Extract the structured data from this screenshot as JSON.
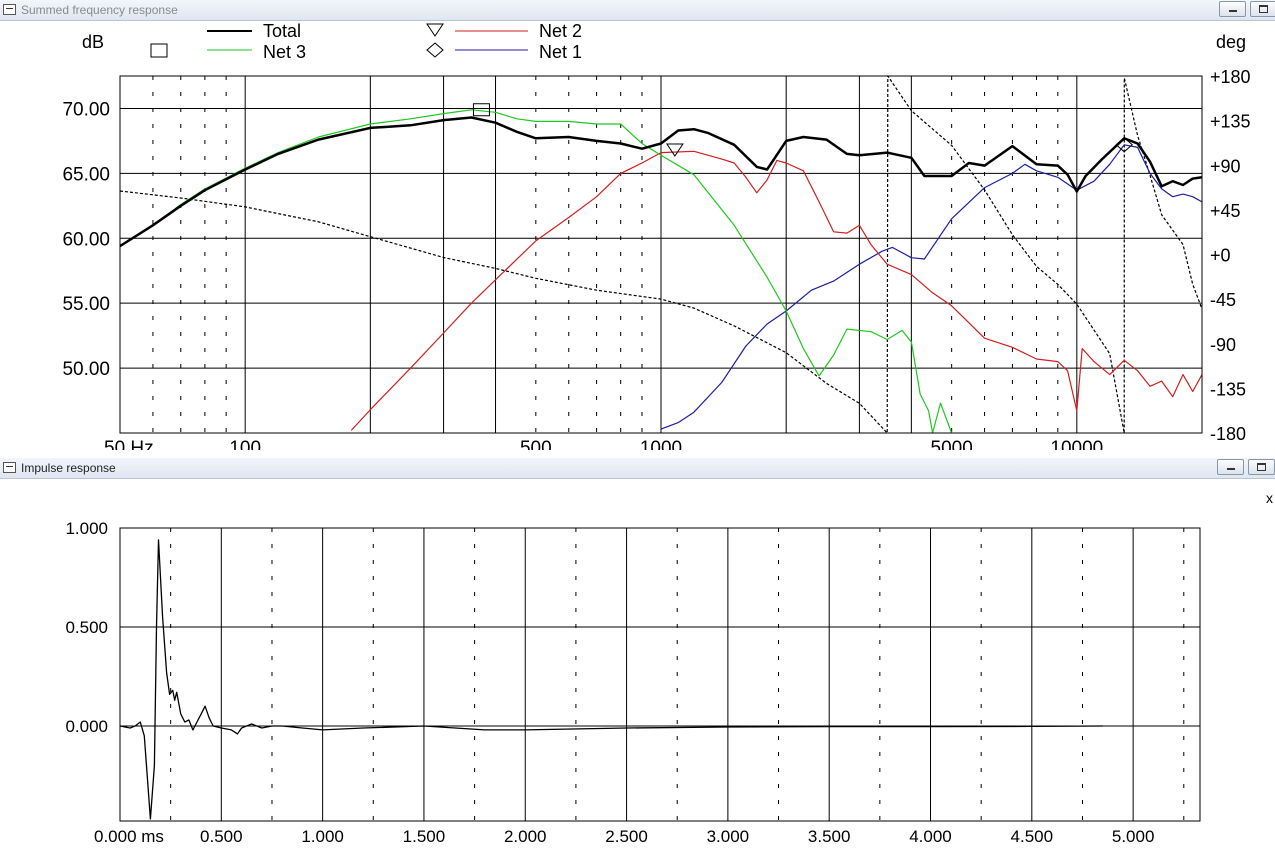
{
  "windows": {
    "freq": {
      "title": "Summed frequency response"
    },
    "impulse": {
      "title": "Impulse response",
      "side_label": "x"
    }
  },
  "freq_chart": {
    "unit_left": "dB",
    "unit_right": "deg",
    "y_ticks": [
      "70.00",
      "65.00",
      "60.00",
      "55.00",
      "50.00"
    ],
    "phase_ticks": [
      "+180",
      "+135",
      "+90",
      "+45",
      "+0",
      "-45",
      "-90",
      "-135",
      "-180"
    ],
    "x_ticks": [
      "50 Hz",
      "100",
      "500",
      "1000",
      "5000",
      "10000"
    ],
    "legend": {
      "total": "Total",
      "net3": "Net 3",
      "net2": "Net 2",
      "net1": "Net 1"
    }
  },
  "impulse_chart": {
    "y_ticks": [
      "1.000",
      "0.500",
      "0.000"
    ],
    "x_ticks": [
      "0.000 ms",
      "0.500",
      "1.000",
      "1.500",
      "2.000",
      "2.500",
      "3.000",
      "3.500",
      "4.000",
      "4.500",
      "5.000"
    ]
  },
  "colors": {
    "total": "#000000",
    "net3": "#1ec81e",
    "net2": "#d21e1e",
    "net1": "#1e1ea0",
    "phase": "#000000"
  },
  "chart_data": [
    {
      "type": "line",
      "title": "Summed frequency response",
      "xscale": "log",
      "xlim": [
        50,
        20000
      ],
      "ylim": [
        45,
        72.5
      ],
      "y2lim": [
        -180,
        180
      ],
      "ylabel": "dB",
      "y2label": "deg",
      "grid": true,
      "legend_position": "top",
      "series": [
        {
          "name": "Total",
          "axis": "left",
          "color": "#000000",
          "points": [
            [
              50,
              59.4
            ],
            [
              60,
              61
            ],
            [
              70,
              62.5
            ],
            [
              80,
              63.7
            ],
            [
              100,
              65.3
            ],
            [
              120,
              66.5
            ],
            [
              150,
              67.6
            ],
            [
              200,
              68.5
            ],
            [
              250,
              68.7
            ],
            [
              300,
              69.1
            ],
            [
              350,
              69.3
            ],
            [
              400,
              68.9
            ],
            [
              450,
              68.2
            ],
            [
              500,
              67.7
            ],
            [
              600,
              67.8
            ],
            [
              700,
              67.5
            ],
            [
              800,
              67.3
            ],
            [
              900,
              66.9
            ],
            [
              1000,
              67.3
            ],
            [
              1100,
              68.3
            ],
            [
              1200,
              68.4
            ],
            [
              1300,
              68.1
            ],
            [
              1500,
              67.2
            ],
            [
              1700,
              65.5
            ],
            [
              1800,
              65.3
            ],
            [
              2000,
              67.5
            ],
            [
              2200,
              67.8
            ],
            [
              2500,
              67.6
            ],
            [
              2800,
              66.5
            ],
            [
              3000,
              66.4
            ],
            [
              3500,
              66.6
            ],
            [
              4000,
              66.2
            ],
            [
              4300,
              64.8
            ],
            [
              5000,
              64.8
            ],
            [
              5500,
              65.8
            ],
            [
              6000,
              65.6
            ],
            [
              7000,
              67.1
            ],
            [
              8000,
              65.7
            ],
            [
              9000,
              65.6
            ],
            [
              9500,
              64.9
            ],
            [
              10000,
              63.6
            ],
            [
              10500,
              64.8
            ],
            [
              11500,
              66.1
            ],
            [
              13000,
              67.7
            ],
            [
              14000,
              67.3
            ],
            [
              15000,
              65.9
            ],
            [
              16000,
              64.0
            ],
            [
              17000,
              64.4
            ],
            [
              18000,
              64.1
            ],
            [
              19000,
              64.6
            ],
            [
              20000,
              64.7
            ]
          ]
        },
        {
          "name": "Net 3",
          "axis": "left",
          "color": "#1ec81e",
          "points": [
            [
              50,
              59.4
            ],
            [
              60,
              61
            ],
            [
              70,
              62.6
            ],
            [
              80,
              63.8
            ],
            [
              100,
              65.4
            ],
            [
              120,
              66.6
            ],
            [
              150,
              67.8
            ],
            [
              200,
              68.8
            ],
            [
              250,
              69.2
            ],
            [
              300,
              69.6
            ],
            [
              350,
              69.9
            ],
            [
              400,
              69.7
            ],
            [
              450,
              69.2
            ],
            [
              500,
              69.0
            ],
            [
              600,
              69.0
            ],
            [
              700,
              68.8
            ],
            [
              800,
              68.8
            ],
            [
              900,
              67.3
            ],
            [
              1000,
              66.4
            ],
            [
              1200,
              64.9
            ],
            [
              1500,
              61.0
            ],
            [
              1800,
              57.0
            ],
            [
              2000,
              54.4
            ],
            [
              2200,
              51.5
            ],
            [
              2400,
              49.4
            ],
            [
              2600,
              51.0
            ],
            [
              2800,
              53.0
            ],
            [
              3200,
              52.8
            ],
            [
              3500,
              52.2
            ],
            [
              3800,
              52.9
            ],
            [
              4000,
              52.0
            ],
            [
              4200,
              48.0
            ],
            [
              4400,
              46.7
            ],
            [
              4500,
              45.0
            ],
            [
              4700,
              47.3
            ],
            [
              5000,
              45.0
            ]
          ]
        },
        {
          "name": "Net 2",
          "axis": "left",
          "color": "#d21e1e",
          "points": [
            [
              180,
              45.2
            ],
            [
              200,
              46.8
            ],
            [
              250,
              50.0
            ],
            [
              300,
              52.7
            ],
            [
              350,
              55.0
            ],
            [
              400,
              56.8
            ],
            [
              500,
              59.8
            ],
            [
              600,
              61.6
            ],
            [
              700,
              63.2
            ],
            [
              800,
              65.0
            ],
            [
              900,
              65.8
            ],
            [
              1000,
              66.6
            ],
            [
              1200,
              66.7
            ],
            [
              1400,
              66.1
            ],
            [
              1500,
              65.8
            ],
            [
              1600,
              64.7
            ],
            [
              1700,
              63.5
            ],
            [
              1800,
              64.5
            ],
            [
              1900,
              66.0
            ],
            [
              2000,
              65.8
            ],
            [
              2200,
              65.2
            ],
            [
              2400,
              62.8
            ],
            [
              2600,
              60.5
            ],
            [
              2800,
              60.4
            ],
            [
              3000,
              61.0
            ],
            [
              3200,
              59.5
            ],
            [
              3500,
              58.0
            ],
            [
              4000,
              57.2
            ],
            [
              4500,
              55.8
            ],
            [
              5000,
              54.8
            ],
            [
              6000,
              52.3
            ],
            [
              7000,
              51.6
            ],
            [
              8000,
              50.7
            ],
            [
              9000,
              50.5
            ],
            [
              9500,
              49.8
            ],
            [
              10000,
              46.7
            ],
            [
              10300,
              51.5
            ],
            [
              11000,
              50.5
            ],
            [
              12000,
              49.5
            ],
            [
              13000,
              50.6
            ],
            [
              14000,
              49.8
            ],
            [
              15000,
              48.6
            ],
            [
              16000,
              49.0
            ],
            [
              17000,
              47.8
            ],
            [
              18000,
              49.5
            ],
            [
              19000,
              48.2
            ],
            [
              20000,
              49.5
            ]
          ]
        },
        {
          "name": "Net 1",
          "axis": "left",
          "color": "#1e1ea0",
          "points": [
            [
              1000,
              45.3
            ],
            [
              1100,
              45.8
            ],
            [
              1200,
              46.6
            ],
            [
              1400,
              48.9
            ],
            [
              1600,
              51.7
            ],
            [
              1800,
              53.4
            ],
            [
              2000,
              54.4
            ],
            [
              2300,
              56.0
            ],
            [
              2600,
              56.7
            ],
            [
              3000,
              58.0
            ],
            [
              3400,
              59.0
            ],
            [
              3600,
              59.3
            ],
            [
              4000,
              58.5
            ],
            [
              4300,
              58.4
            ],
            [
              5000,
              61.5
            ],
            [
              6000,
              63.9
            ],
            [
              7000,
              65.0
            ],
            [
              7500,
              65.7
            ],
            [
              8000,
              65.2
            ],
            [
              9000,
              64.7
            ],
            [
              10000,
              63.7
            ],
            [
              11000,
              64.4
            ],
            [
              12000,
              65.7
            ],
            [
              13000,
              67.2
            ],
            [
              14000,
              67.0
            ],
            [
              15000,
              65.0
            ],
            [
              16000,
              63.8
            ],
            [
              17000,
              63.2
            ],
            [
              18000,
              63.4
            ],
            [
              19000,
              63.2
            ],
            [
              20000,
              62.8
            ]
          ]
        },
        {
          "name": "Total phase",
          "axis": "right",
          "color": "#000000",
          "dashed": true,
          "points": [
            [
              50,
              64
            ],
            [
              70,
              57
            ],
            [
              100,
              48
            ],
            [
              150,
              33
            ],
            [
              200,
              18
            ],
            [
              300,
              -3
            ],
            [
              400,
              -14
            ],
            [
              500,
              -24
            ],
            [
              700,
              -36
            ],
            [
              1000,
              -45
            ],
            [
              1200,
              -54
            ],
            [
              1500,
              -72
            ],
            [
              2000,
              -99
            ],
            [
              2500,
              -130
            ],
            [
              3000,
              -150
            ],
            [
              3500,
              -180
            ],
            [
              3510,
              180
            ],
            [
              4000,
              145
            ],
            [
              5000,
              110
            ],
            [
              6000,
              65
            ],
            [
              7000,
              20
            ],
            [
              8000,
              -12
            ],
            [
              9000,
              -30
            ],
            [
              10000,
              -50
            ],
            [
              12000,
              -100
            ],
            [
              13000,
              -180
            ],
            [
              13010,
              178
            ],
            [
              14000,
              120
            ],
            [
              15000,
              80
            ],
            [
              16000,
              40
            ],
            [
              18000,
              10
            ],
            [
              19000,
              -30
            ],
            [
              20000,
              -55
            ]
          ]
        }
      ],
      "markers": [
        {
          "series": "Net 3",
          "shape": "square",
          "x": 370,
          "y": 69.9
        },
        {
          "series": "Net 2",
          "shape": "triangle-down",
          "x": 1080,
          "y": 66.8
        },
        {
          "series": "Net 1",
          "shape": "diamond",
          "x": 13000,
          "y": 67.2
        }
      ]
    },
    {
      "type": "line",
      "title": "Impulse response",
      "xlim": [
        0,
        5.33
      ],
      "ylim": [
        -0.48,
        1.0
      ],
      "xunit": "ms",
      "grid": true,
      "series": [
        {
          "color": "#000000",
          "points": [
            [
              0,
              0.0
            ],
            [
              0.05,
              -0.01
            ],
            [
              0.075,
              0.0
            ],
            [
              0.1,
              0.02
            ],
            [
              0.12,
              -0.05
            ],
            [
              0.15,
              -0.47
            ],
            [
              0.17,
              -0.2
            ],
            [
              0.18,
              0.5
            ],
            [
              0.19,
              0.94
            ],
            [
              0.21,
              0.55
            ],
            [
              0.23,
              0.27
            ],
            [
              0.245,
              0.16
            ],
            [
              0.26,
              0.18
            ],
            [
              0.27,
              0.13
            ],
            [
              0.28,
              0.17
            ],
            [
              0.3,
              0.06
            ],
            [
              0.32,
              0.02
            ],
            [
              0.34,
              0.03
            ],
            [
              0.36,
              -0.02
            ],
            [
              0.38,
              0.02
            ],
            [
              0.4,
              0.06
            ],
            [
              0.42,
              0.1
            ],
            [
              0.44,
              0.04
            ],
            [
              0.46,
              0.0
            ],
            [
              0.5,
              -0.01
            ],
            [
              0.55,
              -0.02
            ],
            [
              0.58,
              -0.04
            ],
            [
              0.6,
              -0.01
            ],
            [
              0.65,
              0.01
            ],
            [
              0.7,
              -0.01
            ],
            [
              0.75,
              0.0
            ],
            [
              0.8,
              0.0
            ],
            [
              0.9,
              -0.01
            ],
            [
              1.0,
              -0.02
            ],
            [
              1.2,
              -0.01
            ],
            [
              1.5,
              0.0
            ],
            [
              1.8,
              -0.02
            ],
            [
              2.0,
              -0.02
            ],
            [
              2.5,
              -0.01
            ],
            [
              3.0,
              -0.005
            ],
            [
              3.5,
              -0.003
            ],
            [
              4.0,
              -0.003
            ],
            [
              4.5,
              -0.002
            ],
            [
              4.85,
              0.0
            ]
          ]
        }
      ]
    }
  ]
}
